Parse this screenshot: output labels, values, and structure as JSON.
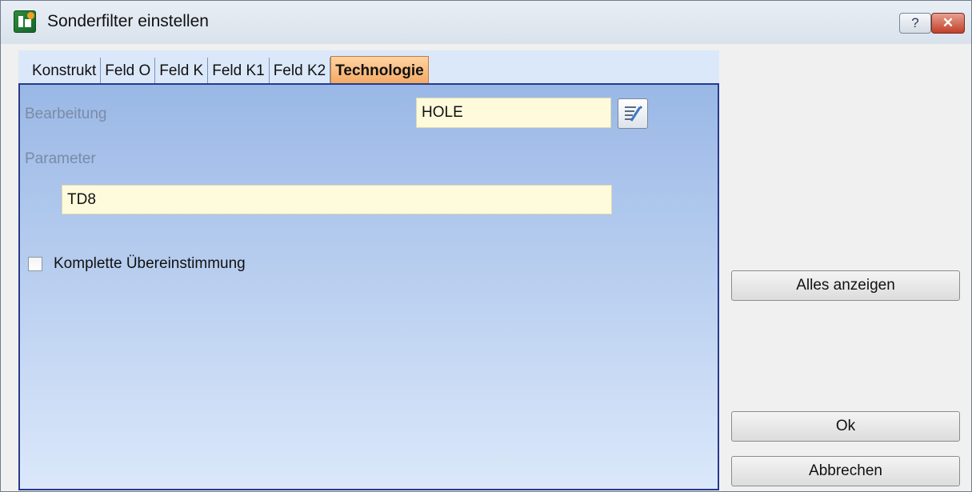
{
  "window": {
    "title": "Sonderfilter einstellen",
    "help_label": "?",
    "close_label": "✕"
  },
  "tabs": [
    {
      "label": "Konstrukt",
      "active": false
    },
    {
      "label": "Feld O",
      "active": false
    },
    {
      "label": "Feld K",
      "active": false
    },
    {
      "label": "Feld K1",
      "active": false
    },
    {
      "label": "Feld K2",
      "active": false
    },
    {
      "label": "Technologie",
      "active": true
    }
  ],
  "form": {
    "bearbeitung_label": "Bearbeitung",
    "bearbeitung_value": "HOLE",
    "parameter_label": "Parameter",
    "parameter_value": "TD8",
    "checkbox_label": "Komplette Übereinstimmung",
    "checkbox_checked": false
  },
  "buttons": {
    "show_all": "Alles anzeigen",
    "ok": "Ok",
    "cancel": "Abbrechen"
  },
  "colors": {
    "panel_border": "#273a8c",
    "active_tab": "#f3a862",
    "field_bg": "#fefbdc"
  }
}
